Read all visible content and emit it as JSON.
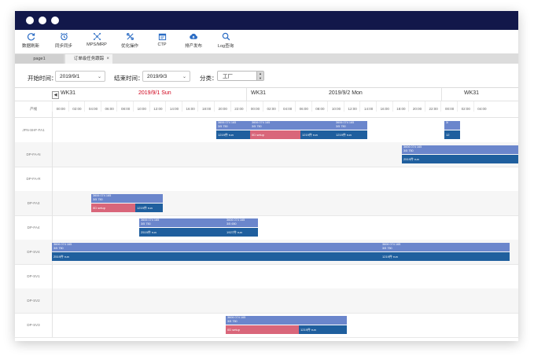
{
  "toolbar": {
    "items": [
      {
        "label": "数据刷新",
        "icon": "refresh-icon"
      },
      {
        "label": "同步同步",
        "icon": "alarm-clock-icon"
      },
      {
        "label": "MPS/MRP",
        "icon": "network-icon"
      },
      {
        "label": "优化操作",
        "icon": "optimize-icon"
      },
      {
        "label": "CTP",
        "icon": "calendar-icon"
      },
      {
        "label": "排产发布",
        "icon": "cloud-upload-icon"
      },
      {
        "label": "Log查询",
        "icon": "search-icon"
      }
    ]
  },
  "tabs": [
    {
      "label": "page1"
    },
    {
      "label": "订单级任务跟踪",
      "close": "×"
    }
  ],
  "filters": {
    "start_label": "开始时间：",
    "start_value": "2019/9/1",
    "end_label": "结束时间：",
    "end_value": "2019/9/3",
    "category_label": "分类：",
    "category_value": "工厂"
  },
  "gantt": {
    "nav_prev": "◀",
    "weeks": [
      {
        "week": "WK31",
        "day": "2019/9/1 Sun",
        "highlight": true
      },
      {
        "week": "WK31",
        "day": "2019/9/2 Mon",
        "highlight": false
      },
      {
        "week": "WK31",
        "day": "",
        "highlight": false
      }
    ],
    "row_header": "产线",
    "hours": [
      "00:00",
      "02:00",
      "04:00",
      "06:00",
      "08:00",
      "10:00",
      "12:00",
      "14:00",
      "16:00",
      "18:00",
      "20:00",
      "22:00",
      "00:00",
      "02:00",
      "04:00",
      "06:00",
      "08:00",
      "10:00",
      "12:00",
      "14:00",
      "16:00",
      "18:00",
      "20:00",
      "22:00",
      "00:00",
      "02:00",
      "04:00"
    ],
    "rows": [
      {
        "label": "JFN-SHF-FA1"
      },
      {
        "label": "DP-FA-N"
      },
      {
        "label": "DP-FA-R"
      },
      {
        "label": "DP-FA3"
      },
      {
        "label": "DP-FA4"
      },
      {
        "label": "DP-SV4"
      },
      {
        "label": "DP-SV1"
      },
      {
        "label": "DP-SV2"
      },
      {
        "label": "DP-SV3"
      }
    ],
    "tasks": [
      {
        "row": 0,
        "top1": "3606 074 165",
        "top2": "3/5  750",
        "setup": "",
        "run": "1219件 run"
      },
      {
        "row": 0,
        "top1": "3606 074 165",
        "top2": "3/5  750",
        "setup": "0D setup",
        "run": "1219件 run"
      },
      {
        "row": 0,
        "top1": "3606 074 165",
        "top2": "3/5  750",
        "setup": "",
        "run": "1219件 run"
      },
      {
        "row": 0,
        "top1": "3/",
        "top2": "",
        "setup": "",
        "run": "12"
      },
      {
        "row": 1,
        "top1": "3606 074 165",
        "top2": "3/5  750",
        "setup": "",
        "run": "2519件 run"
      },
      {
        "row": 3,
        "top1": "3606 074 165",
        "top2": "3/5  750",
        "setup": "0D setup",
        "run": "1219件 run"
      },
      {
        "row": 4,
        "top1": "3606 074 165",
        "top2": "3/5  750",
        "setup": "",
        "run": "2519件 run"
      },
      {
        "row": 4,
        "top1": "3606 074 165",
        "top2": "3/5  650",
        "setup": "",
        "run": "1927件 run"
      },
      {
        "row": 5,
        "top1": "3606 074 165",
        "top2": "3/5  750",
        "setup": "",
        "run": "2519件 run"
      },
      {
        "row": 5,
        "top1": "3606 074 165",
        "top2": "3/5  750",
        "setup": "",
        "run": "1219件 run"
      },
      {
        "row": 8,
        "top1": "3606 074 165",
        "top2": "3/5  750",
        "setup": "0D setup",
        "run": "1219件 run"
      }
    ]
  },
  "colors": {
    "titlebar": "#12184a",
    "task_header": "#6b86cc",
    "task_run": "#1f5f9e",
    "task_setup": "#d9667a",
    "date_highlight": "#d0021b"
  }
}
